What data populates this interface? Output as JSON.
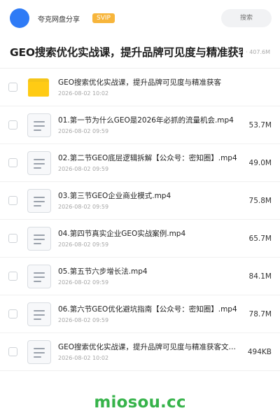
{
  "header": {
    "brand": "夸克网盘分享",
    "badge": "SVIP",
    "search_placeholder": "搜索"
  },
  "folder": {
    "title": "GEO搜索优化实战课，提升品牌可见度与精准获客",
    "total_size": "· 407.6M"
  },
  "items": [
    {
      "type": "folder",
      "name": "GEO搜索优化实战课，提升品牌可见度与精准获客",
      "date": "2026-08-02 10:02",
      "size": ""
    },
    {
      "type": "file",
      "name": "01.第一节为什么GEO是2026年必抓的流量机会.mp4",
      "date": "2026-08-02 09:59",
      "size": "53.7M"
    },
    {
      "type": "file",
      "name": "02.第二节GEO底层逻辑拆解【公众号：密知圈】.mp4",
      "date": "2026-08-02 09:59",
      "size": "49.0M"
    },
    {
      "type": "file",
      "name": "03.第三节GEO企业商业模式.mp4",
      "date": "2026-08-02 09:59",
      "size": "75.8M"
    },
    {
      "type": "file",
      "name": "04.第四节真实企业GEO实战案例.mp4",
      "date": "2026-08-02 09:59",
      "size": "65.7M"
    },
    {
      "type": "file",
      "name": "05.第五节六步增长法.mp4",
      "date": "2026-08-02 09:59",
      "size": "84.1M"
    },
    {
      "type": "file",
      "name": "06.第六节GEO优化避坑指南【公众号：密知圈】.mp4",
      "date": "2026-08-02 09:59",
      "size": "78.7M"
    },
    {
      "type": "file",
      "name": "GEO搜索优化实战课，提升品牌可见度与精准获客文档.docx",
      "date": "2026-08-02 10:02",
      "size": "494KB"
    }
  ],
  "watermark": "miosou.cc",
  "colors": {
    "accent": "#2f7bf6",
    "badge": "#f7b53b",
    "folder": "#ffcb14",
    "watermark": "#36b34a"
  }
}
